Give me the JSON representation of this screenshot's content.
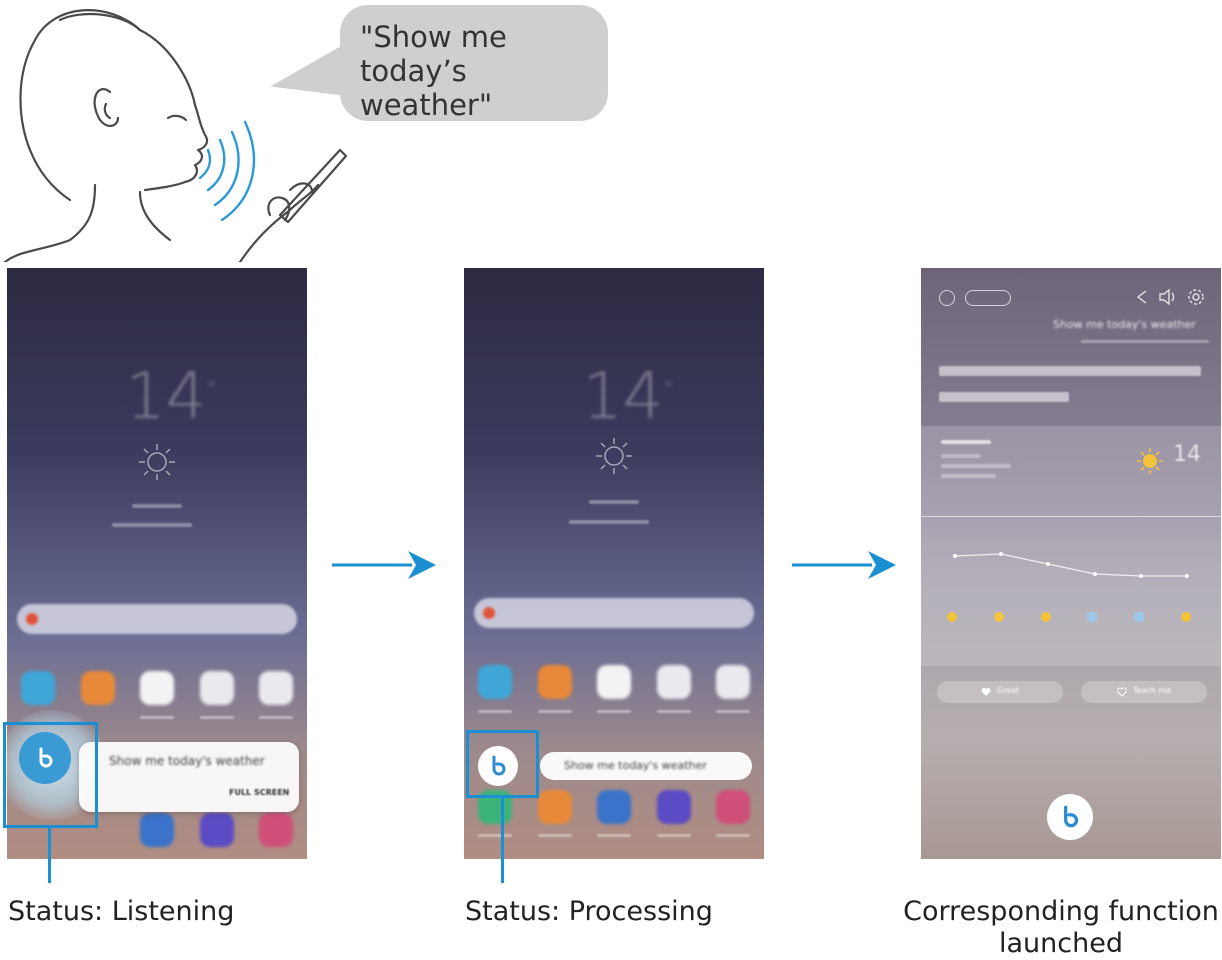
{
  "speech": {
    "quote": "\"Show me today’s weather\""
  },
  "phone1": {
    "clock_value": "14",
    "query_text": "Show me today's weather",
    "action_text": "FULL SCREEN",
    "status_label": "Status: Listening"
  },
  "phone2": {
    "clock_value": "14",
    "query_text": "Show me today's weather",
    "status_label": "Status: Processing"
  },
  "phone3": {
    "query_text": "Show me today's weather",
    "temperature": "14",
    "like_button": "Great",
    "teach_button": "Teach me",
    "status_label_line1": "Corresponding function",
    "status_label_line2": "launched"
  },
  "colors": {
    "accent_blue": "#1a8fd1",
    "bubble_gray": "#cfcfcf",
    "bixby_teal": "#2a8bd0"
  },
  "icons": [
    "person-speaking-illustration",
    "arrow-right-icon",
    "bixby-icon",
    "sun-icon",
    "share-icon",
    "volume-icon",
    "settings-icon",
    "heart-icon"
  ]
}
